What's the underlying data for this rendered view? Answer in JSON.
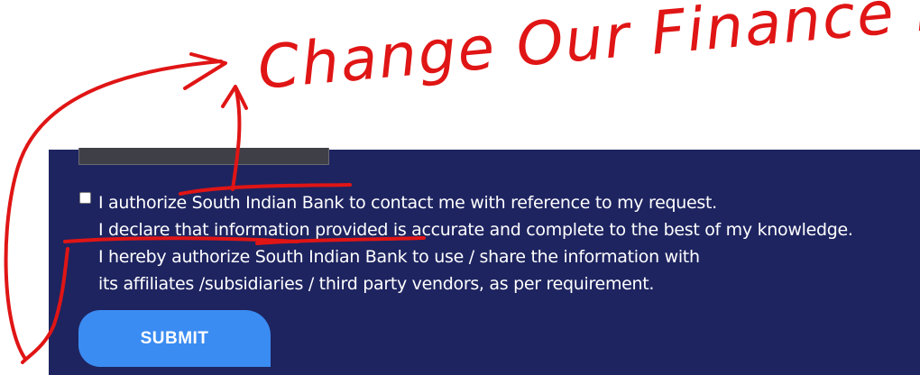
{
  "form": {
    "consent": {
      "line1": "I authorize South Indian Bank to contact me with reference to my request.",
      "line2": "I declare that information provided is accurate and complete to the best of my knowledge.",
      "line3": "I hereby authorize South Indian Bank to use / share the information with",
      "line4": "its affiliates /subsidiaries / third party vendors, as per requirement."
    },
    "submit_label": "SUBMIT"
  },
  "annotation": {
    "text": "Change Our Finance Name",
    "color": "#e01515"
  },
  "colors": {
    "panel": "#1e2460",
    "button": "#3b8cf2"
  }
}
